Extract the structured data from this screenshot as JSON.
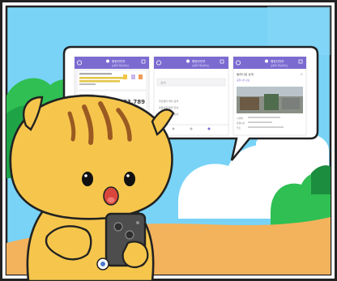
{
  "screens": [
    {
      "header_title": "행정안전부",
      "header_sub": "모바일 행정서비스",
      "count": "83,789"
    },
    {
      "header_title": "행정안전부",
      "header_sub": "모바일 행정서비스",
      "search_value": "검색",
      "rows": [
        "주민센터 위치 검색",
        "민원서류 발급 안내",
        "공공시설 예약 안내"
      ]
    },
    {
      "header_title": "행정안전부",
      "header_sub": "모바일 행정서비스",
      "detail_title": "둘레시설 상세",
      "detail_sub": "공원시설 정보",
      "info_rows": [
        "시설명",
        "운영시간",
        "주소"
      ]
    }
  ],
  "colors": {
    "sky": "#79d3f7",
    "ground": "#f3b25c",
    "cloud": "#ffffff",
    "bush": "#2fbf53",
    "creature_fur": "#f6c64c",
    "creature_stripe": "#9a5a22",
    "phone": "#4d4d4d",
    "app_header": "#7b6bd1"
  }
}
